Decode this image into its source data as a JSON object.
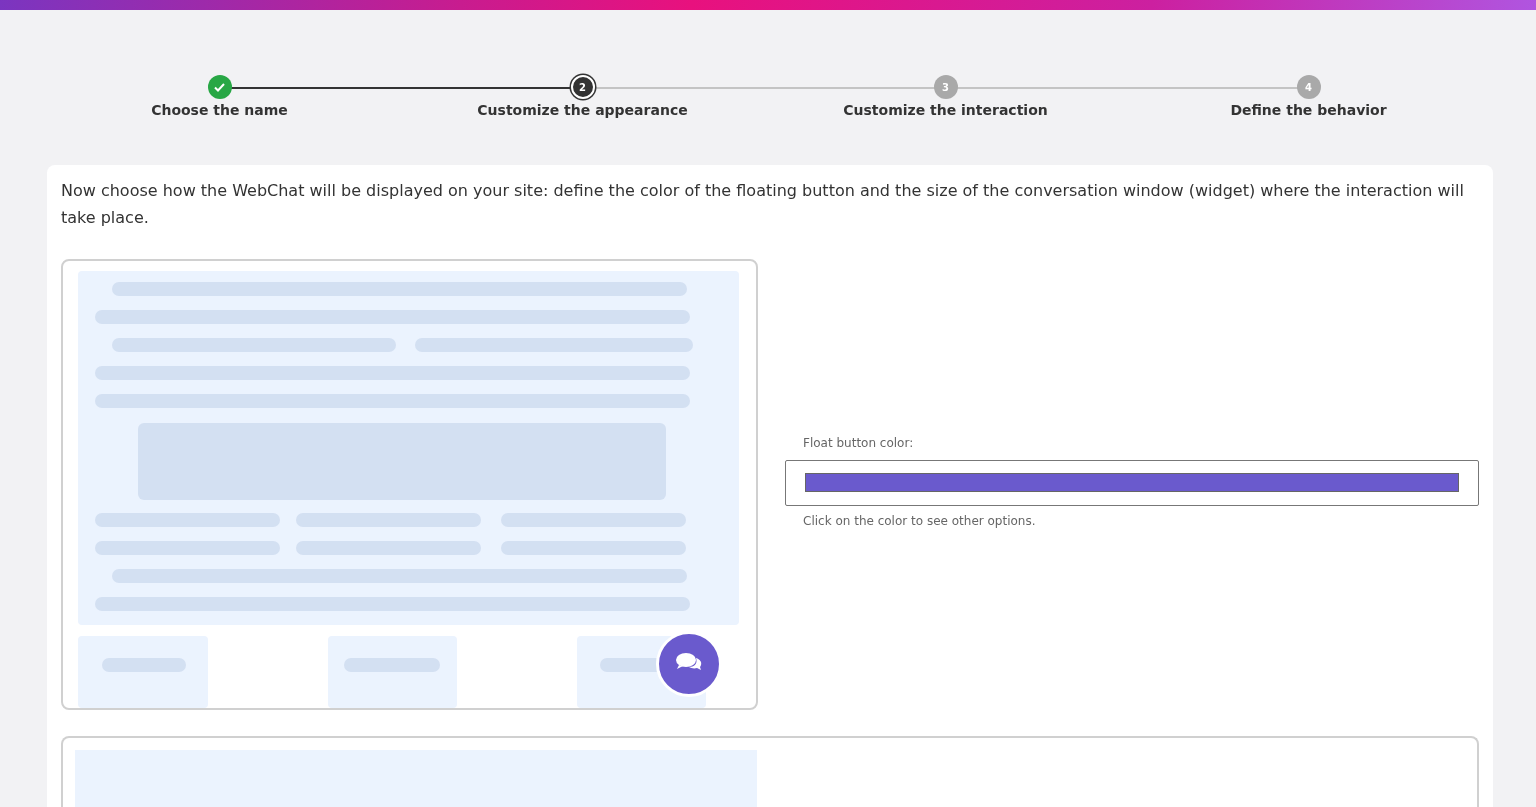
{
  "steps": [
    {
      "label": "Choose the name",
      "completed": true,
      "selected": false
    },
    {
      "number": "2",
      "label": "Customize the appearance",
      "completed": false,
      "selected": true
    },
    {
      "number": "3",
      "label": "Customize the interaction",
      "completed": false,
      "selected": false
    },
    {
      "number": "4",
      "label": "Define the behavior",
      "completed": false,
      "selected": false
    }
  ],
  "intro": "Now choose how the WebChat will be displayed on your site: define the color of the floating button and the size of the conversation window (widget) where the interaction will take place.",
  "color_picker": {
    "label": "Float button color:",
    "color": "#6a5acd",
    "hint": "Click on the color to see other options."
  }
}
